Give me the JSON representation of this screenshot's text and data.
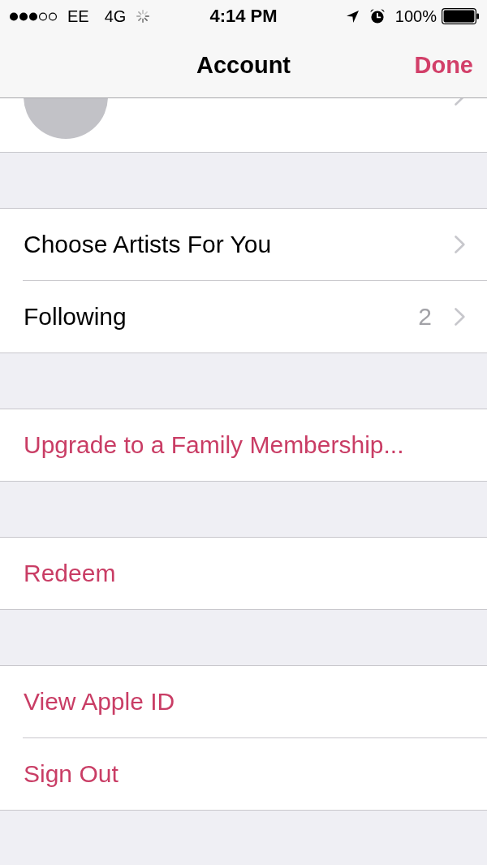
{
  "status_bar": {
    "carrier": "EE",
    "network": "4G",
    "time": "4:14 PM",
    "battery": "100%"
  },
  "nav_bar": {
    "title": "Account",
    "button": "Done"
  },
  "groups": [
    {
      "rows": [
        {
          "kind": "navigation",
          "label": "Choose Artists For You"
        },
        {
          "kind": "navigation",
          "label": "Following",
          "count": "2"
        }
      ]
    },
    {
      "rows": [
        {
          "kind": "action",
          "label": "Upgrade to a Family Membership..."
        }
      ]
    },
    {
      "rows": [
        {
          "kind": "action",
          "label": "Redeem"
        }
      ]
    },
    {
      "rows": [
        {
          "kind": "action",
          "label": "View Apple ID"
        },
        {
          "kind": "action",
          "label": "Sign Out"
        }
      ]
    }
  ]
}
